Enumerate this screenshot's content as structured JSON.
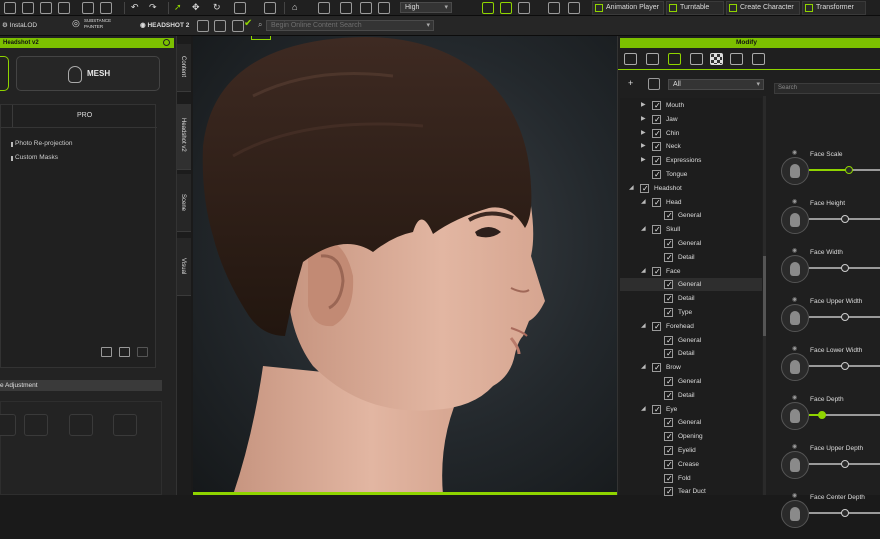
{
  "toolbar_top": {
    "quality": "High",
    "buttons": [
      "Animation Player",
      "Turntable",
      "Create Character",
      "Transformer"
    ]
  },
  "toolbar_plugins": {
    "insta_lod": "InstaLOD",
    "substance": "SUBSTANCE PAINTER",
    "headshot": "HEADSHOT 2",
    "search_placeholder": "Begin Online Content Search"
  },
  "left_panel": {
    "title": "Headshot v2",
    "mesh_label": "MESH",
    "pro_label": "PRO",
    "items": [
      "Photo Re-projection",
      "Custom Masks"
    ],
    "adjustment_label": "e Adjustment"
  },
  "vertical_tabs": [
    "Content",
    "Headshot v2",
    "Scene",
    "Visual"
  ],
  "right_panel": {
    "title": "Modify",
    "filter_value": "All",
    "search_placeholder": "Search",
    "tree": [
      {
        "label": "Mouth",
        "level": 2,
        "arrow": true
      },
      {
        "label": "Jaw",
        "level": 2,
        "arrow": true
      },
      {
        "label": "Chin",
        "level": 2,
        "arrow": true
      },
      {
        "label": "Neck",
        "level": 2,
        "arrow": true
      },
      {
        "label": "Expressions",
        "level": 2,
        "arrow": true
      },
      {
        "label": "Tongue",
        "level": 2,
        "arrow": false
      },
      {
        "label": "Headshot",
        "level": 1,
        "arrow": true
      },
      {
        "label": "Head",
        "level": 2,
        "arrow": true
      },
      {
        "label": "General",
        "level": 3,
        "arrow": false
      },
      {
        "label": "Skull",
        "level": 2,
        "arrow": true
      },
      {
        "label": "General",
        "level": 3,
        "arrow": false
      },
      {
        "label": "Detail",
        "level": 3,
        "arrow": false
      },
      {
        "label": "Face",
        "level": 2,
        "arrow": true
      },
      {
        "label": "General",
        "level": 3,
        "arrow": false,
        "selected": true
      },
      {
        "label": "Detail",
        "level": 3,
        "arrow": false
      },
      {
        "label": "Type",
        "level": 3,
        "arrow": false
      },
      {
        "label": "Forehead",
        "level": 2,
        "arrow": true
      },
      {
        "label": "General",
        "level": 3,
        "arrow": false
      },
      {
        "label": "Detail",
        "level": 3,
        "arrow": false
      },
      {
        "label": "Brow",
        "level": 2,
        "arrow": true
      },
      {
        "label": "General",
        "level": 3,
        "arrow": false
      },
      {
        "label": "Detail",
        "level": 3,
        "arrow": false
      },
      {
        "label": "Eye",
        "level": 2,
        "arrow": true
      },
      {
        "label": "General",
        "level": 3,
        "arrow": false
      },
      {
        "label": "Opening",
        "level": 3,
        "arrow": false
      },
      {
        "label": "Eyelid",
        "level": 3,
        "arrow": false
      },
      {
        "label": "Crease",
        "level": 3,
        "arrow": false
      },
      {
        "label": "Fold",
        "level": 3,
        "arrow": false
      },
      {
        "label": "Tear Duct",
        "level": 3,
        "arrow": false
      }
    ],
    "sliders": [
      {
        "label": "Face Scale",
        "value": 0.55,
        "active": true
      },
      {
        "label": "Face Height",
        "value": 0.5,
        "active": false
      },
      {
        "label": "Face Width",
        "value": 0.5,
        "active": false
      },
      {
        "label": "Face Upper Width",
        "value": 0.5,
        "active": false
      },
      {
        "label": "Face Lower Width",
        "value": 0.5,
        "active": false
      },
      {
        "label": "Face Depth",
        "value": 0.18,
        "active": true
      },
      {
        "label": "Face Upper Depth",
        "value": 0.5,
        "active": false
      },
      {
        "label": "Face Center Depth",
        "value": 0.5,
        "active": false
      }
    ]
  }
}
